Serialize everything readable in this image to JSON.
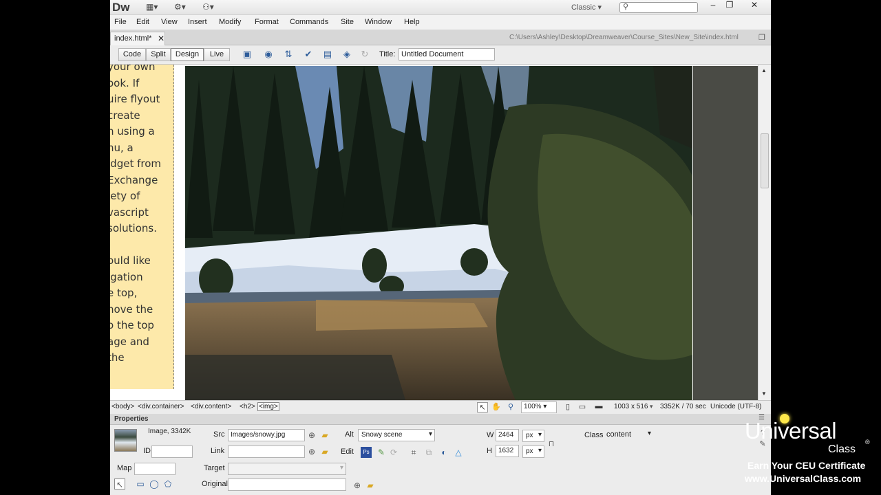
{
  "app": {
    "logo": "Dw",
    "workspace": "Classic",
    "search_placeholder": ""
  },
  "menu": [
    "File",
    "Edit",
    "View",
    "Insert",
    "Modify",
    "Format",
    "Commands",
    "Site",
    "Window",
    "Help"
  ],
  "document": {
    "tab_label": "index.html*",
    "path": "C:\\Users\\Ashley\\Desktop\\Dreamweaver\\Course_Sites\\New_Site\\index.html",
    "title_label": "Title:",
    "title_value": "Untitled Document"
  },
  "view_buttons": [
    "Code",
    "Split",
    "Design",
    "Live"
  ],
  "sidebar_text": [
    "your own",
    "ook. If",
    "uire flyout",
    "create",
    "n using a",
    "nu, a",
    "idget from",
    "Exchange",
    "iety of",
    "vascript",
    "solutions.",
    "",
    "ould like",
    "igation",
    "e top,",
    "nove the",
    "o the top",
    "age and",
    "the"
  ],
  "status": {
    "tags": [
      "<body>",
      "<div.container>",
      "<div.content>",
      "<h2>",
      "<img>"
    ],
    "zoom": "100%",
    "dimensions": "1003 x 516",
    "size_time": "3352K / 70 sec",
    "encoding": "Unicode (UTF-8)"
  },
  "properties": {
    "title": "Properties",
    "type_label": "Image, 3342K",
    "id_label": "ID",
    "id_value": "",
    "src_label": "Src",
    "src_value": "Images/snowy.jpg",
    "link_label": "Link",
    "link_value": "",
    "alt_label": "Alt",
    "alt_value": "Snowy scene",
    "edit_label": "Edit",
    "w_label": "W",
    "w_value": "2464",
    "w_unit": "px",
    "h_label": "H",
    "h_value": "1632",
    "h_unit": "px",
    "class_label": "Class",
    "class_value": "content",
    "map_label": "Map",
    "map_value": "",
    "target_label": "Target",
    "target_value": "",
    "original_label": "Original",
    "original_value": ""
  },
  "branding": {
    "name": "Universal",
    "sub": "Class",
    "registered": "®",
    "tagline": "Earn Your CEU Certificate",
    "url": "www.UniversalClass.com"
  }
}
